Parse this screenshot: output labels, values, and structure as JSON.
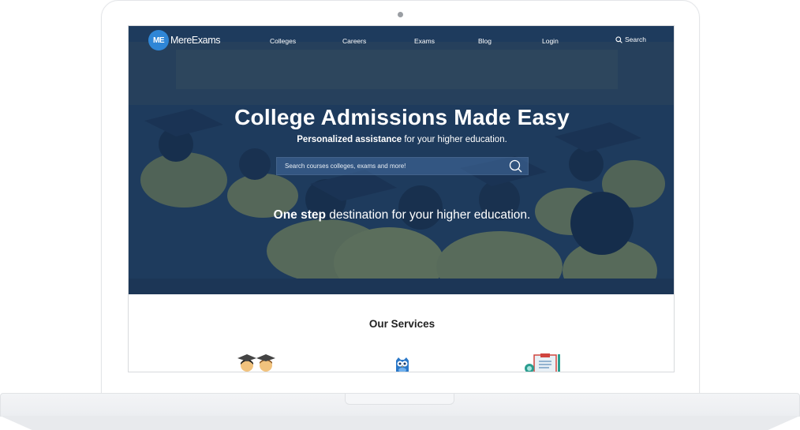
{
  "nav": {
    "logo_mark": "ME",
    "logo_text": "MereExams",
    "items": [
      {
        "label": "Colleges"
      },
      {
        "label": "Careers"
      },
      {
        "label": "Exams"
      },
      {
        "label": "Blog"
      },
      {
        "label": "Login"
      }
    ],
    "search_label": "Search"
  },
  "hero": {
    "title": "College Admissions Made Easy",
    "subtitle_bold": "Personalized assistance",
    "subtitle_rest": " for your higher education.",
    "search_placeholder": "Search courses colleges, exams and more!",
    "tagline_bold": "One step",
    "tagline_rest": " destination for your higher education."
  },
  "services": {
    "title": "Our Services",
    "icons": [
      "graduates-icon",
      "owl-icon",
      "clipboard-icon"
    ]
  },
  "colors": {
    "brand_blue": "#2f86d6",
    "hero_overlay": "#1c4273"
  }
}
